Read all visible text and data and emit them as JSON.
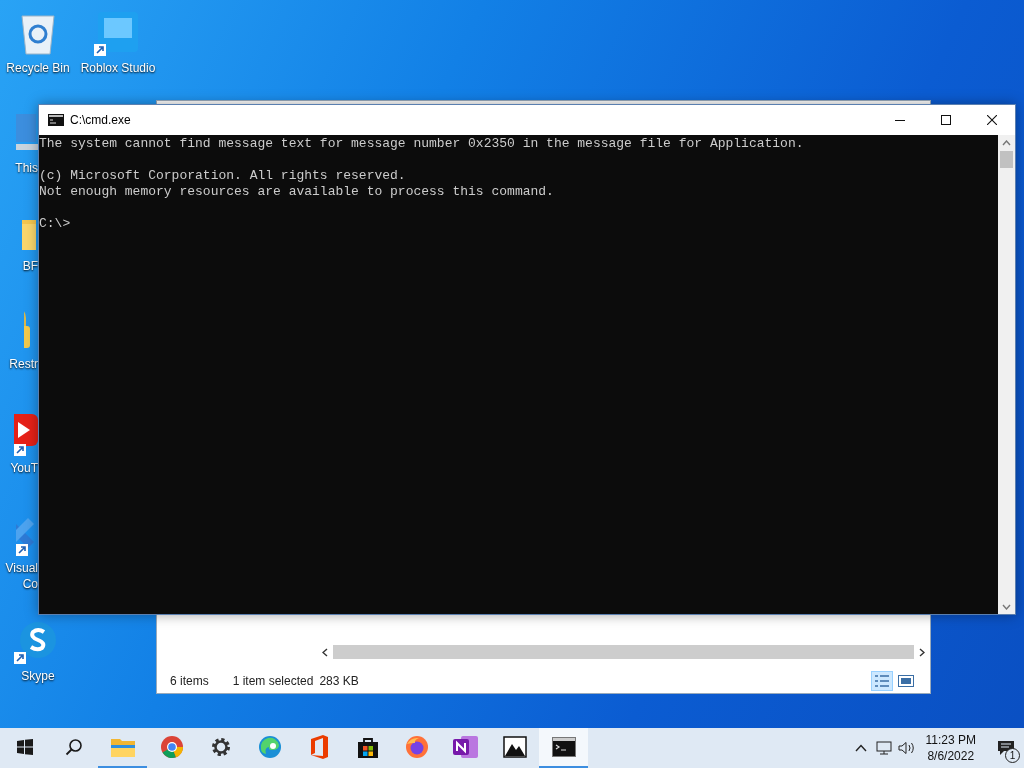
{
  "desktop": {
    "icons": [
      {
        "kind": "recycle-bin",
        "lines": [
          "Recycle Bin"
        ],
        "shortcut": false
      },
      {
        "kind": "roblox",
        "lines": [
          "Roblox Studio"
        ],
        "shortcut": true
      },
      {
        "kind": "computer",
        "lines": [
          "This"
        ],
        "shortcut": false
      },
      {
        "kind": "folder",
        "lines": [
          "BF"
        ],
        "shortcut": false
      },
      {
        "kind": "lock",
        "lines": [
          "Restr"
        ],
        "shortcut": false
      },
      {
        "kind": "youtube",
        "lines": [
          "YouT"
        ],
        "shortcut": true
      },
      {
        "kind": "visual-studio",
        "lines": [
          "Visual",
          "Co"
        ],
        "shortcut": true
      },
      {
        "kind": "skype",
        "lines": [
          "Skype"
        ],
        "shortcut": true
      }
    ]
  },
  "explorer": {
    "status": [
      "6 items",
      "1 item selected",
      "283 KB"
    ],
    "views": [
      {
        "kind": "details",
        "selected": true
      },
      {
        "kind": "large-icons",
        "selected": false
      }
    ]
  },
  "console": {
    "title": "C:\\cmd.exe",
    "blocks": [
      [
        "The system cannot find message text for message number 0x2350 in the message file for Application."
      ],
      [
        "(c) Microsoft Corporation. All rights reserved.",
        "Not enough memory resources are available to process this command."
      ],
      [
        "C:\\>"
      ]
    ]
  },
  "taskbar": {
    "apps": [
      {
        "kind": "start",
        "running": false,
        "selected": false
      },
      {
        "kind": "search",
        "running": false,
        "selected": false
      },
      {
        "kind": "file-explorer",
        "running": true,
        "selected": false
      },
      {
        "kind": "chrome",
        "running": false,
        "selected": false
      },
      {
        "kind": "settings",
        "running": false,
        "selected": false
      },
      {
        "kind": "edge",
        "running": false,
        "selected": false
      },
      {
        "kind": "office",
        "running": false,
        "selected": false
      },
      {
        "kind": "store",
        "running": false,
        "selected": false
      },
      {
        "kind": "firefox",
        "running": false,
        "selected": false
      },
      {
        "kind": "onenote",
        "running": false,
        "selected": false
      },
      {
        "kind": "photos",
        "running": false,
        "selected": false
      },
      {
        "kind": "terminal",
        "running": true,
        "selected": true
      }
    ],
    "time": "11:23 PM",
    "date": "8/6/2022",
    "notifications": "1"
  }
}
